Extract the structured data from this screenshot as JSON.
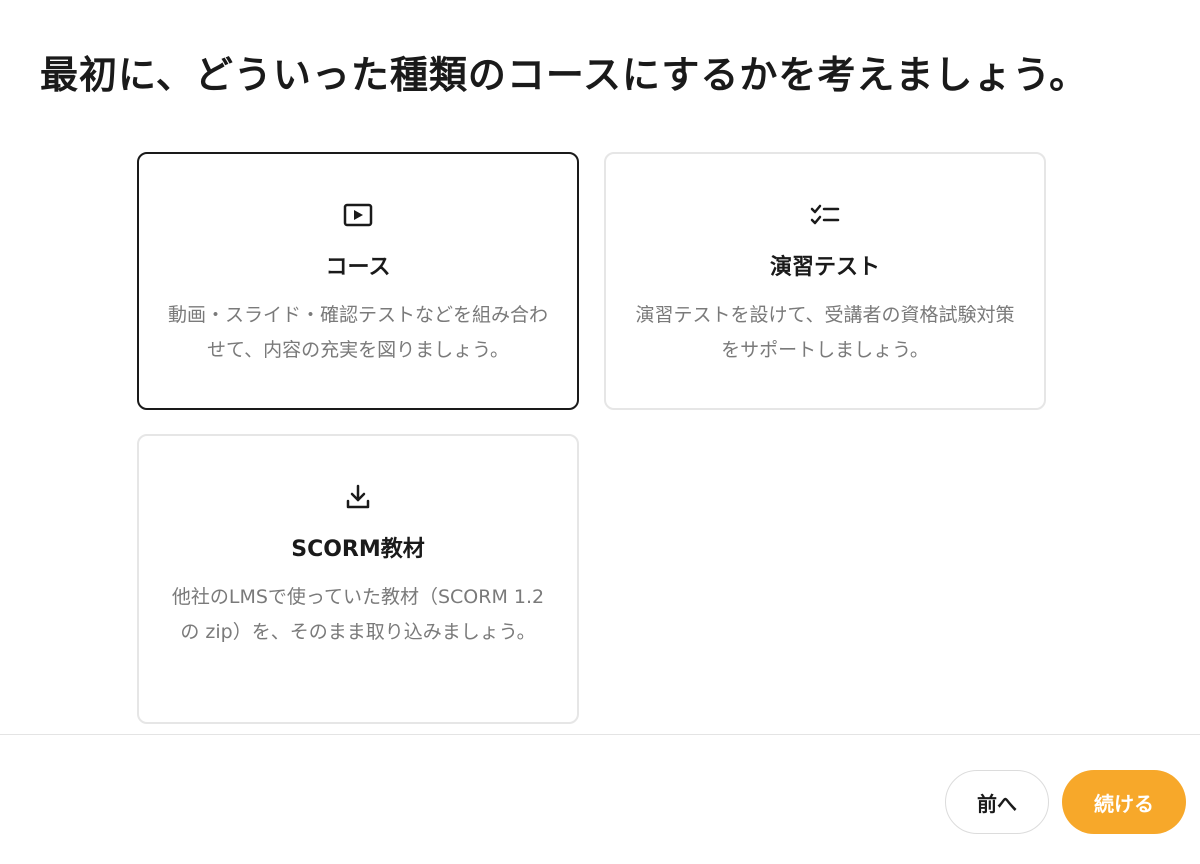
{
  "header": {
    "title": "最初に、どういった種類のコースにするかを考えましょう。"
  },
  "cards": [
    {
      "icon": "play-video-icon",
      "title": "コース",
      "description": "動画・スライド・確認テストなどを組み合わせて、内容の充実を図りましょう。",
      "selected": true
    },
    {
      "icon": "checklist-icon",
      "title": "演習テスト",
      "description": "演習テストを設けて、受講者の資格試験対策をサポートしましょう。",
      "selected": false
    },
    {
      "icon": "download-icon",
      "title": "SCORM教材",
      "description": "他社のLMSで使っていた教材（SCORM 1.2 の zip）を、そのまま取り込みましょう。",
      "selected": false
    }
  ],
  "footer": {
    "prev_label": "前へ",
    "next_label": "続ける"
  },
  "colors": {
    "accent": "#f7a82a",
    "selected_border": "#1a1a1a",
    "card_border": "#e6e6e6",
    "muted_text": "#7a7a7a"
  }
}
